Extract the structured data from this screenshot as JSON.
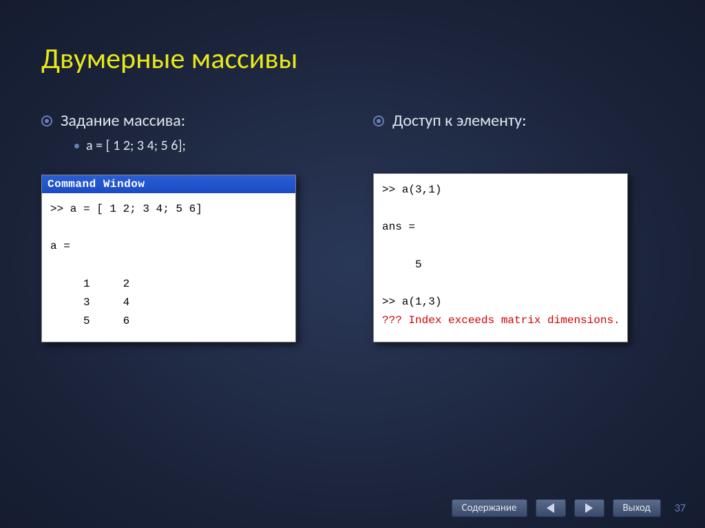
{
  "title": "Двумерные массивы",
  "left": {
    "heading": "Задание массива:",
    "sub": "a = [ 1 2; 3 4; 5 6];",
    "window_title": "Command Window",
    "window_body": ">> a = [ 1 2; 3 4; 5 6]\n\na =\n\n     1     2\n     3     4\n     5     6"
  },
  "right": {
    "heading": "Доступ к элементу:",
    "window_body_plain": ">> a(3,1)\n\nans =\n\n     5\n\n>> a(1,3)\n",
    "window_body_error": "??? Index exceeds matrix dimensions."
  },
  "footer": {
    "contents": "Содержание",
    "exit": "Выход",
    "page": "37"
  }
}
